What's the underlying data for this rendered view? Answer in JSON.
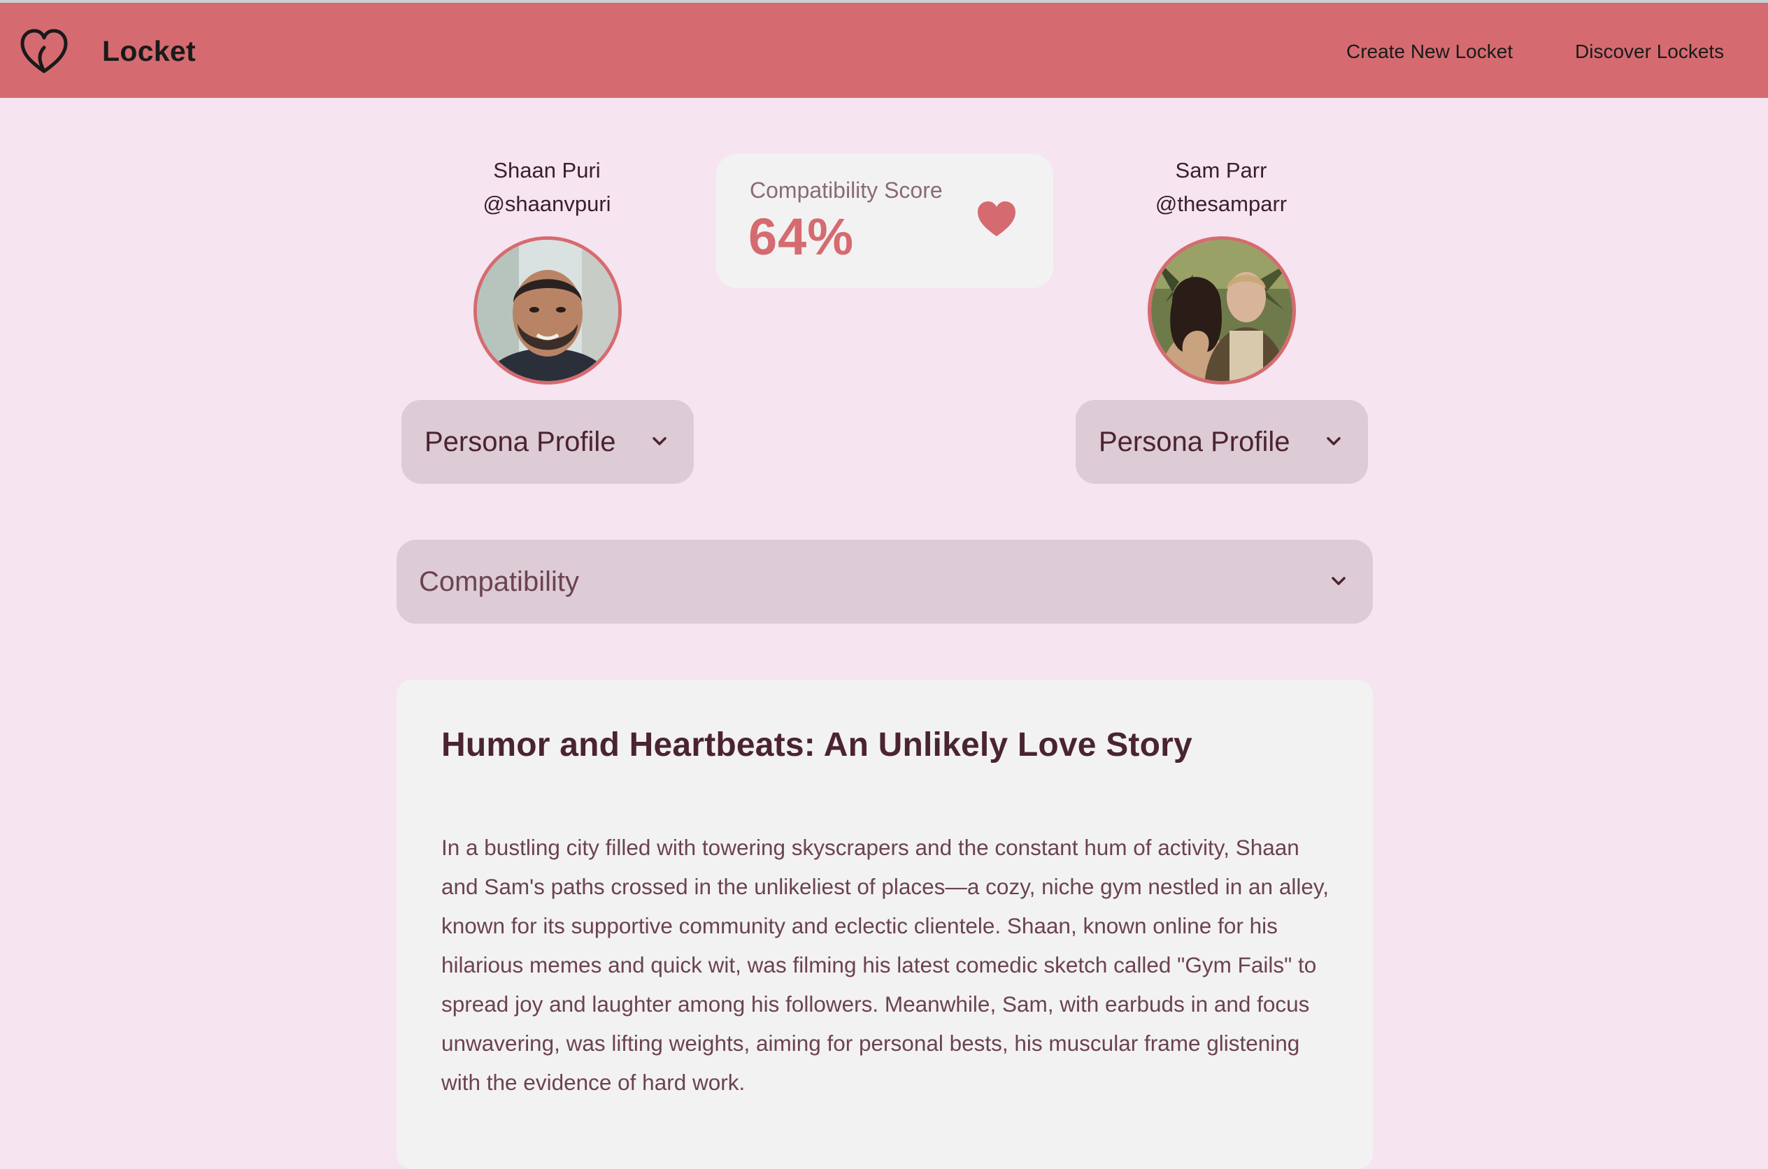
{
  "app": {
    "name": "Locket",
    "logo_icon": "heart-outline-icon"
  },
  "nav": {
    "links": [
      {
        "label": "Create New Locket"
      },
      {
        "label": "Discover Lockets"
      }
    ]
  },
  "people": [
    {
      "name": "Shaan Puri",
      "handle": "@shaanvpuri",
      "profile_label": "Persona Profile"
    },
    {
      "name": "Sam Parr",
      "handle": "@thesamparr",
      "profile_label": "Persona Profile"
    }
  ],
  "score": {
    "label": "Compatibility Score",
    "value": "64%",
    "icon": "heart-icon"
  },
  "compatibility_section": {
    "label": "Compatibility",
    "icon": "chevron-down-icon"
  },
  "story": {
    "title": "Humor and Heartbeats: An Unlikely Love Story",
    "paragraph": "In a bustling city filled with towering skyscrapers and the constant hum of activity, Shaan and Sam's paths crossed in the unlikeliest of places—a cozy, niche gym nestled in an alley, known for its supportive community and eclectic clientele. Shaan, known online for his hilarious memes and quick wit, was filming his latest comedic sketch called \"Gym Fails\" to spread joy and laughter among his followers. Meanwhile, Sam, with earbuds in and focus unwavering, was lifting weights, aiming for personal bests, his muscular frame glistening with the evidence of hard work."
  },
  "colors": {
    "accent": "#d56b70",
    "background": "#f6e4f0",
    "panel": "#ddcbd6",
    "card": "#f3f2f2",
    "text": "#4a2430"
  }
}
